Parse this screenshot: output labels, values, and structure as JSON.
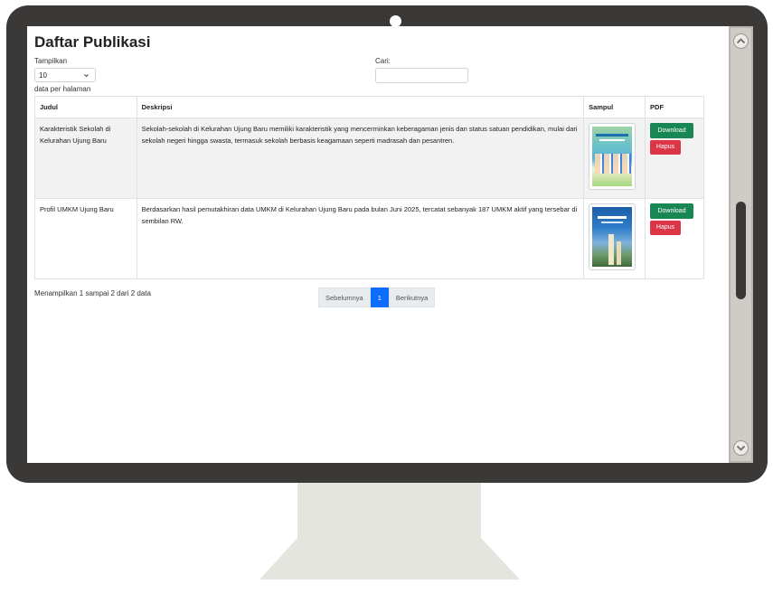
{
  "page": {
    "title": "Daftar Publikasi"
  },
  "controls": {
    "length_label": "Tampilkan",
    "length_value": "10",
    "length_suffix": "data per halaman",
    "search_label": "Cari:",
    "search_value": ""
  },
  "table": {
    "headers": [
      "Judul",
      "Deskripsi",
      "Sampul",
      "PDF"
    ],
    "rows": [
      {
        "judul": "Karakteristik Sekolah di Kelurahan Ujung Baru",
        "deskripsi": "Sekolah-sekolah di Kelurahan Ujung Baru memiliki karakteristik yang mencerminkan keberagaman jenis dan status satuan pendidikan, mulai dari sekolah negeri hingga swasta, termasuk sekolah berbasis keagamaan seperti madrasah dan pesantren.",
        "download_label": "Download",
        "hapus_label": "Hapus"
      },
      {
        "judul": "Profil UMKM Ujung Baru",
        "deskripsi": "Berdasarkan hasil pemutakhiran data UMKM di Kelurahan Ujung Baru pada bulan Juni 2025, tercatat sebanyak 187 UMKM aktif yang tersebar di sembilan RW.",
        "download_label": "Download",
        "hapus_label": "Hapus"
      }
    ]
  },
  "footer": {
    "info": "Menampilkan 1 sampai 2 dari 2 data",
    "prev_label": "Sebelumnya",
    "current_page": "1",
    "next_label": "Berikutnya"
  },
  "colors": {
    "monitor_frame": "#3b3838",
    "download_button": "#198754",
    "hapus_button": "#dc3545",
    "active_page": "#0d6efd",
    "stand": "#e5e5e0"
  }
}
